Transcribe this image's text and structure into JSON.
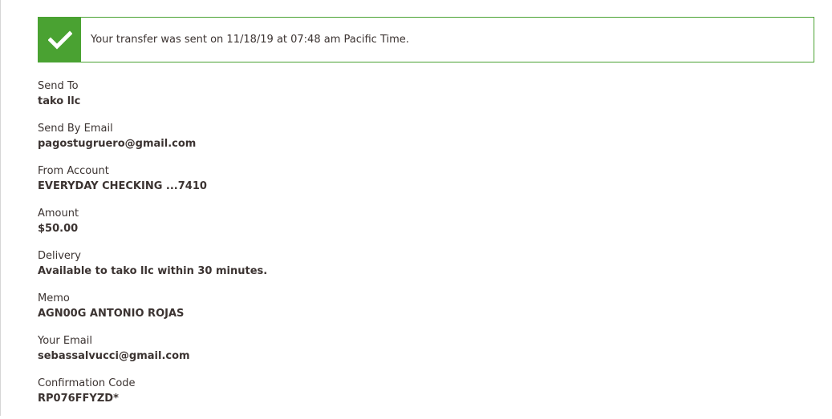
{
  "alert": {
    "icon": "checkmark-icon",
    "message": "Your transfer was sent on 11/18/19 at 07:48 am Pacific Time.",
    "accent_color": "#4aa232"
  },
  "details": [
    {
      "label": "Send To",
      "value": "tako llc"
    },
    {
      "label": "Send By Email",
      "value": "pagostugruero@gmail.com"
    },
    {
      "label": "From Account",
      "value": "EVERYDAY CHECKING ...7410"
    },
    {
      "label": "Amount",
      "value": "$50.00"
    },
    {
      "label": "Delivery",
      "value": "Available to tako llc within 30 minutes."
    },
    {
      "label": "Memo",
      "value": "AGN00G ANTONIO ROJAS"
    },
    {
      "label": "Your Email",
      "value": "sebassalvucci@gmail.com"
    },
    {
      "label": "Confirmation Code",
      "value": "RP076FFYZD*"
    }
  ]
}
